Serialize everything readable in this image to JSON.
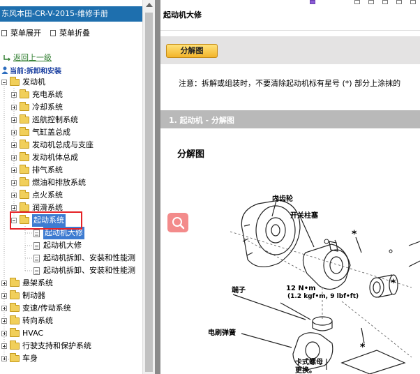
{
  "sidebar": {
    "window_title": "东风本田-CR-V-2015-维修手册",
    "menu_expand": "菜单展开",
    "menu_collapse": "菜单折叠",
    "back_link": "返回上一级",
    "current_label": "当前:拆卸和安装",
    "tree": {
      "engine": "发动机",
      "charging": "充电系统",
      "cooling": "冷却系统",
      "cruise": "巡航控制系统",
      "cylinder_head": "气缸盖总成",
      "engine_assembly": "发动机总成与支座",
      "engine_block": "发动机体总成",
      "exhaust": "排气系统",
      "fuel_emission": "燃油和排放系统",
      "ignition": "点火系统",
      "lubrication": "润滑系统",
      "starting": "起动系统",
      "starting_children": [
        "起动机大修",
        "起动机大修",
        "起动机拆卸、安装和性能测",
        "起动机拆卸、安装和性能测"
      ],
      "suspension": "悬架系统",
      "brakes": "制动器",
      "transmission": "变速/传动系统",
      "steering": "转向系统",
      "hvac": "HVAC",
      "driving_support": "行驶支持和保护系统",
      "body": "车身"
    }
  },
  "content": {
    "page_title": "起动机大修",
    "exploded_button": "分解图",
    "note": "注意：拆解或组装时，不要清除起动机标有星号 (*) 部分上涂抹的",
    "section_title": "1. 起动机 - 分解图",
    "diagram_heading": "分解图",
    "diagram_labels": {
      "pinion": "内齿轮",
      "switch_post": "开关柱塞",
      "asterisk": "*",
      "terminal": "端子",
      "torque": "12 N•m",
      "torque_sub": "(1.2 kgf•m, 9 lbf•ft)",
      "brush_spring": "电刷弹簧",
      "cotter_nut": "卡式螺母",
      "replace": "更换。"
    }
  },
  "colors": {
    "title_bar": "#1e6fae",
    "selection": "#3d7bd1",
    "highlight_box": "#e52226",
    "button": "#f3b42a",
    "section_bar": "#b9b9b9"
  }
}
